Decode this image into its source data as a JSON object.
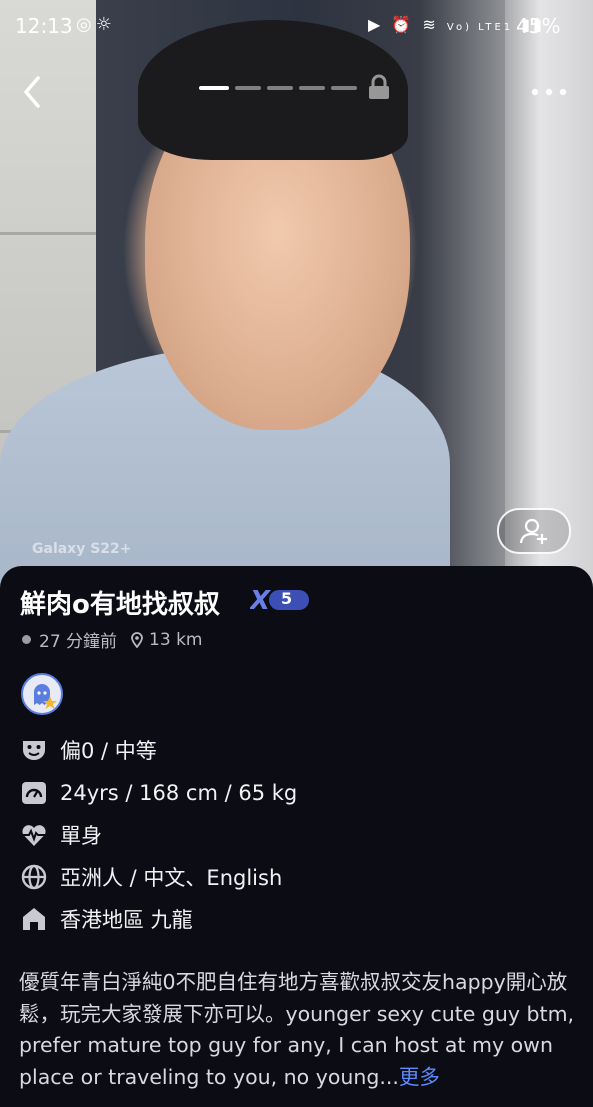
{
  "status_bar": {
    "time": "12:13",
    "network": "Vo) LTE1",
    "battery": "45%"
  },
  "photo": {
    "watermark": "Galaxy S22+",
    "gallery_total": 5,
    "gallery_active": 1
  },
  "profile": {
    "display_name": "鮮肉o有地找叔叔",
    "badge_level": "5",
    "last_seen": "27 分鐘前",
    "distance": "13 km",
    "details": {
      "position": "偏0 / 中等",
      "stats": "24yrs / 168 cm / 65 kg",
      "relationship": "單身",
      "ethnicity_language": "亞洲人 / 中文、English",
      "location": "香港地區 九龍"
    },
    "bio": "優質年青白淨純0不肥自住有地方喜歡叔叔交友happy開心放鬆，玩完大家發展下亦可以。younger sexy cute guy btm, prefer mature top  guy for any, I can host at my own place or traveling to you, no young...",
    "more_label": "更多"
  },
  "colors": {
    "sheet_bg": "#0c0c15",
    "link": "#5b8cff",
    "badge": "#4a5fd0"
  },
  "icons": {
    "back": "chevron-left-icon",
    "lock": "lock-icon",
    "more": "more-dots-icon",
    "add_friend": "add-friend-icon",
    "position": "mask-icon",
    "stats": "body-icon",
    "relationship": "heartbeat-icon",
    "ethnicity": "globe-icon",
    "location": "home-icon"
  }
}
